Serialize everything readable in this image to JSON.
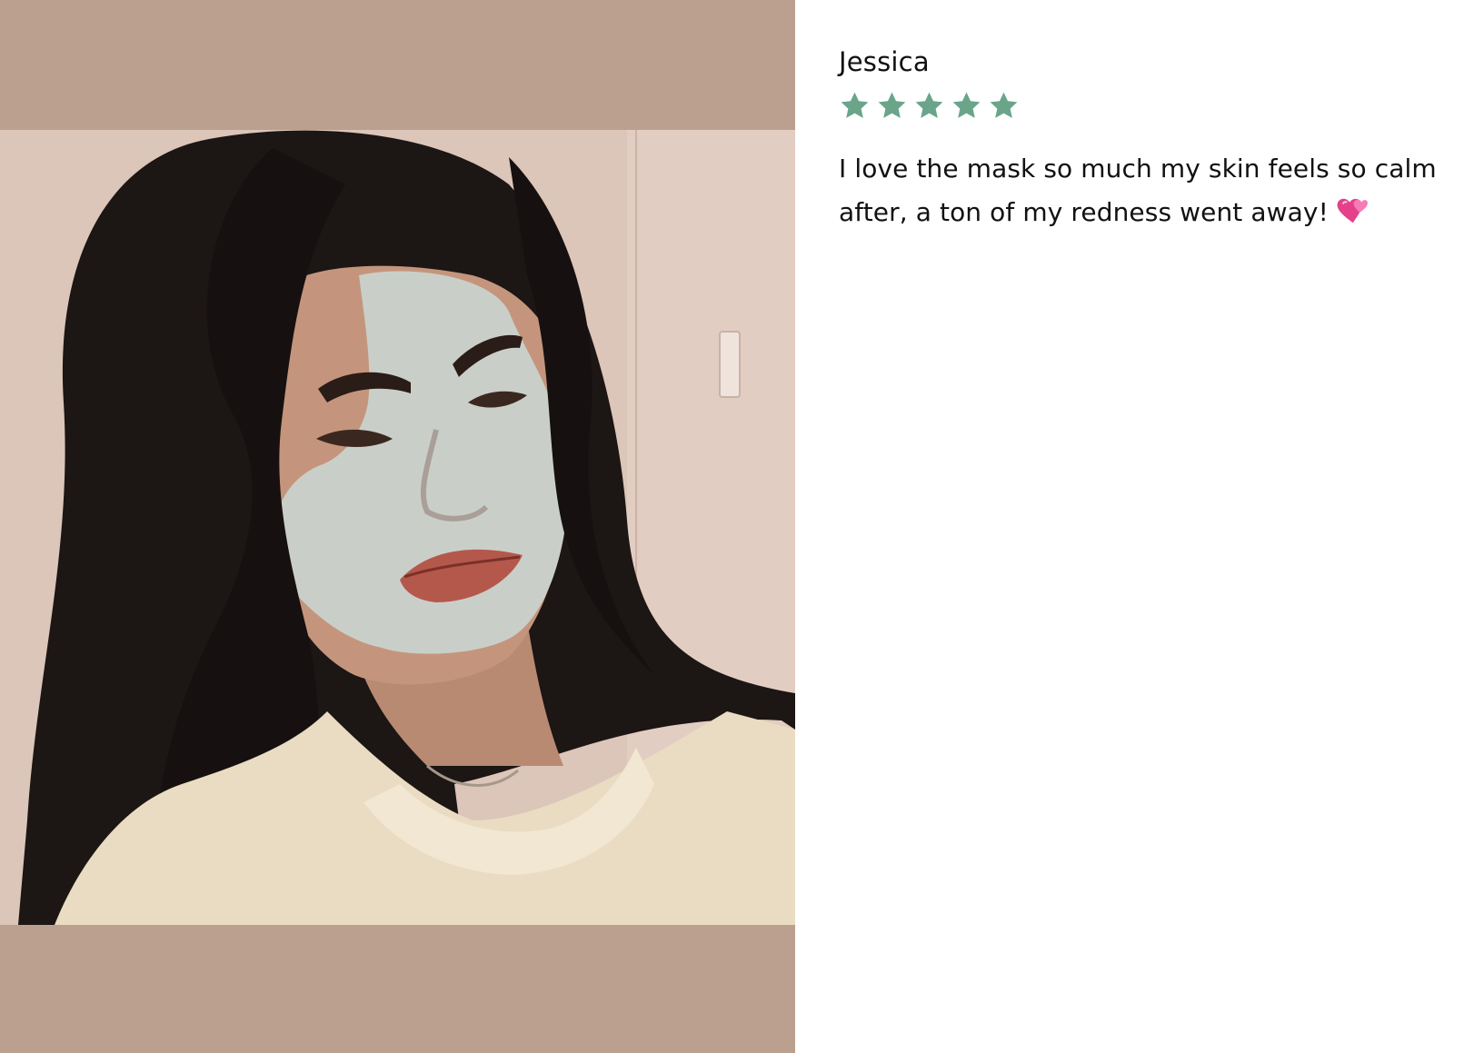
{
  "review": {
    "reviewer_name": "Jessica",
    "rating": 5,
    "rating_max": 5,
    "text": "I love the mask so much my skin feels so calm after, a ton of my redness went away!",
    "emoji": "heart-icon"
  },
  "icons": {
    "star": "star-icon",
    "heart": "heart-icon"
  },
  "colors": {
    "star_fill": "#6aa58a",
    "photo_backdrop": "#bba08f",
    "text": "#111111",
    "heart": "#e5418a"
  }
}
